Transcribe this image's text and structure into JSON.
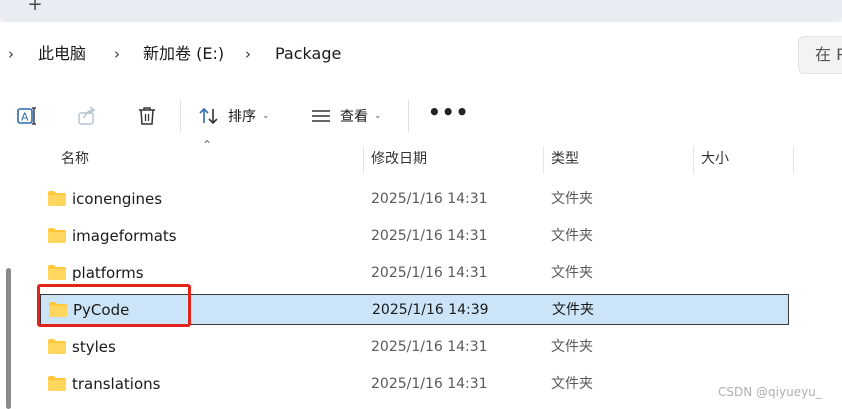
{
  "tabs": {
    "new_tab_glyph": "+"
  },
  "breadcrumb": {
    "items": [
      {
        "label": "此电脑"
      },
      {
        "label": "新加卷 (E:)"
      },
      {
        "label": "Package"
      }
    ],
    "separator": "›"
  },
  "search": {
    "partial_text": "在 P"
  },
  "toolbar": {
    "sort_label": "排序",
    "view_label": "查看",
    "more_glyph": "•••",
    "icons": [
      "rename-icon",
      "share-icon",
      "delete-icon",
      "sort-icon",
      "view-icon"
    ]
  },
  "columns": [
    {
      "label": "名称"
    },
    {
      "label": "修改日期"
    },
    {
      "label": "类型"
    },
    {
      "label": "大小"
    }
  ],
  "files": [
    {
      "name": "iconengines",
      "modified": "2025/1/16 14:31",
      "type": "文件夹",
      "selected": false
    },
    {
      "name": "imageformats",
      "modified": "2025/1/16 14:31",
      "type": "文件夹",
      "selected": false
    },
    {
      "name": "platforms",
      "modified": "2025/1/16 14:31",
      "type": "文件夹",
      "selected": false
    },
    {
      "name": "PyCode",
      "modified": "2025/1/16 14:39",
      "type": "文件夹",
      "selected": true
    },
    {
      "name": "styles",
      "modified": "2025/1/16 14:31",
      "type": "文件夹",
      "selected": false
    },
    {
      "name": "translations",
      "modified": "2025/1/16 14:31",
      "type": "文件夹",
      "selected": false
    }
  ],
  "colors": {
    "selection_bg": "#cce4f7",
    "annotation_red": "#e2231a",
    "folder_yellow": "#ffc83d"
  },
  "watermark": "CSDN @qiyueyu_"
}
